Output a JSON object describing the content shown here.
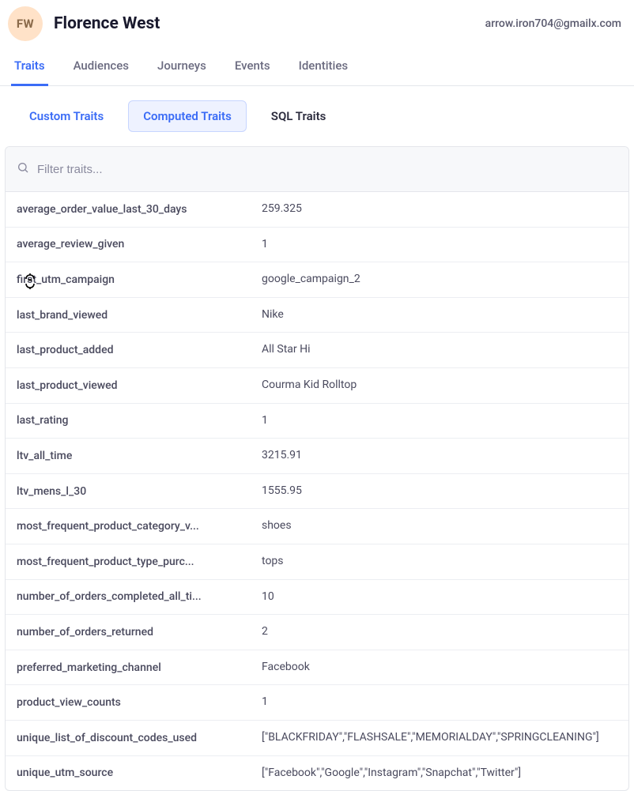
{
  "header": {
    "avatar_initials": "FW",
    "user_name": "Florence West",
    "user_email": "arrow.iron704@gmailx.com"
  },
  "tabs_primary": [
    {
      "label": "Traits",
      "active": true
    },
    {
      "label": "Audiences",
      "active": false
    },
    {
      "label": "Journeys",
      "active": false
    },
    {
      "label": "Events",
      "active": false
    },
    {
      "label": "Identities",
      "active": false
    }
  ],
  "tabs_secondary": [
    {
      "label": "Custom Traits",
      "kind": "custom",
      "active": false
    },
    {
      "label": "Computed Traits",
      "kind": "computed",
      "active": true
    },
    {
      "label": "SQL Traits",
      "kind": "sql",
      "active": false
    }
  ],
  "filter": {
    "placeholder": "Filter traits..."
  },
  "traits": [
    {
      "key": "average_order_value_last_30_days",
      "value": "259.325"
    },
    {
      "key": "average_review_given",
      "value": "1"
    },
    {
      "key": "first_utm_campaign",
      "value": "google_campaign_2"
    },
    {
      "key": "last_brand_viewed",
      "value": "Nike"
    },
    {
      "key": "last_product_added",
      "value": "All Star Hi"
    },
    {
      "key": "last_product_viewed",
      "value": "Courma Kid Rolltop"
    },
    {
      "key": "last_rating",
      "value": "1"
    },
    {
      "key": "ltv_all_time",
      "value": "3215.91"
    },
    {
      "key": "ltv_mens_l_30",
      "value": "1555.95"
    },
    {
      "key": "most_frequent_product_category_v...",
      "value": "shoes"
    },
    {
      "key": "most_frequent_product_type_purc...",
      "value": "tops"
    },
    {
      "key": "number_of_orders_completed_all_ti...",
      "value": "10"
    },
    {
      "key": "number_of_orders_returned",
      "value": "2"
    },
    {
      "key": "preferred_marketing_channel",
      "value": "Facebook"
    },
    {
      "key": "product_view_counts",
      "value": "1"
    },
    {
      "key": "unique_list_of_discount_codes_used",
      "value": "[\"BLACKFRIDAY\",\"FLASHSALE\",\"MEMORIALDAY\",\"SPRINGCLEANING\"]"
    },
    {
      "key": "unique_utm_source",
      "value": "[\"Facebook\",\"Google\",\"Instagram\",\"Snapchat\",\"Twitter\"]"
    }
  ]
}
